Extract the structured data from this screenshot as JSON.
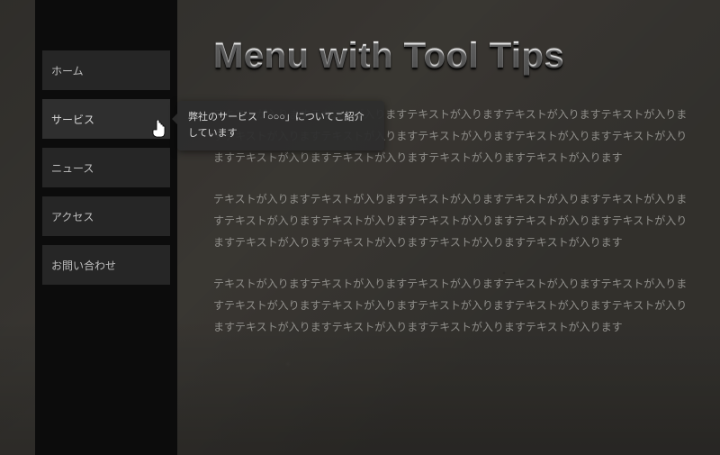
{
  "title": "Menu with Tool Tips",
  "sidebar": {
    "items": [
      {
        "label": "ホーム"
      },
      {
        "label": "サービス"
      },
      {
        "label": "ニュース"
      },
      {
        "label": "アクセス"
      },
      {
        "label": "お問い合わせ"
      }
    ]
  },
  "tooltip": {
    "text": "弊社のサービス「○○○」についてご紹介しています"
  },
  "paragraphs": [
    "テキストが入りますテキストが入りますテキストが入りますテキストが入りますテキストが入りますテキストが入りますテキストが入りますテキストが入りますテキストが入りますテキストが入りますテキストが入りますテキストが入りますテキストが入りますテキストが入ります",
    "テキストが入りますテキストが入りますテキストが入りますテキストが入りますテキストが入りますテキストが入りますテキストが入りますテキストが入りますテキストが入りますテキストが入りますテキストが入りますテキストが入りますテキストが入りますテキストが入ります",
    "テキストが入りますテキストが入りますテキストが入りますテキストが入りますテキストが入りますテキストが入りますテキストが入りますテキストが入りますテキストが入りますテキストが入りますテキストが入りますテキストが入りますテキストが入りますテキストが入ります"
  ]
}
